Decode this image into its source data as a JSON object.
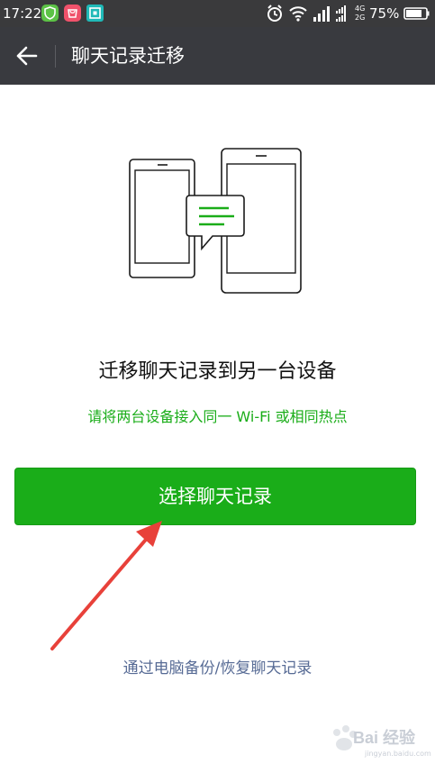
{
  "status_bar": {
    "time": "17:22",
    "battery": "75%",
    "network_labels": [
      "4G",
      "2G"
    ],
    "icons": [
      "security-app-icon",
      "shopping-app-icon",
      "scanner-app-icon",
      "alarm-icon",
      "wifi-icon",
      "signal-icon",
      "signal-4g-2g-icon",
      "battery-icon"
    ]
  },
  "header": {
    "back_icon": "back-arrow-icon",
    "title": "聊天记录迁移"
  },
  "main": {
    "illustration_icon": "phone-to-tablet-migration-icon",
    "headline": "迁移聊天记录到另一台设备",
    "subtext": "请将两台设备接入同一 Wi-Fi 或相同热点",
    "primary_button": "选择聊天记录",
    "secondary_link": "通过电脑备份/恢复聊天记录"
  },
  "annotation": {
    "arrow_color": "#e8413a"
  },
  "watermark": {
    "text": "Bai 经验",
    "subtext": "jingyan.baidu.com"
  },
  "colors": {
    "accent_green": "#1aad19",
    "app_bar": "#393a3f",
    "link_blue": "#576b95"
  }
}
